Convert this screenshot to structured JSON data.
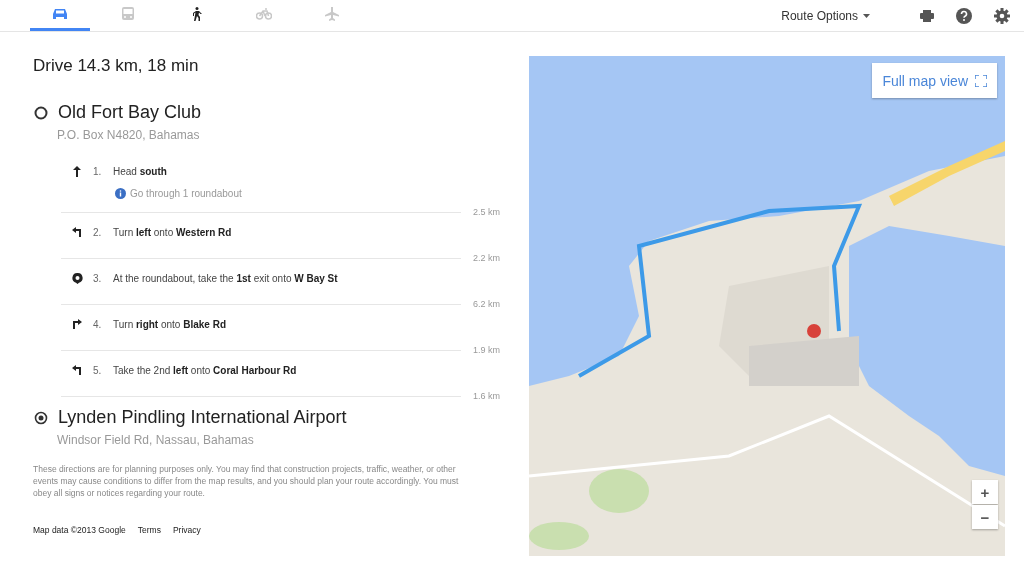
{
  "modes": [
    {
      "kind": "car",
      "selected": true,
      "disabled": false
    },
    {
      "kind": "transit",
      "selected": false,
      "disabled": true
    },
    {
      "kind": "walk",
      "selected": false,
      "disabled": false
    },
    {
      "kind": "bike",
      "selected": false,
      "disabled": true
    },
    {
      "kind": "plane",
      "selected": false,
      "disabled": true
    }
  ],
  "toolbar": {
    "route_options": "Route Options"
  },
  "summary": "Drive 14.3 km, 18 min",
  "origin": {
    "name": "Old Fort Bay Club",
    "address": "P.O. Box N4820, Bahamas"
  },
  "steps": [
    {
      "kind": "straight",
      "number": "1.",
      "text": "Head **south**",
      "note": "Go through 1 roundabout",
      "distance": "2.5 km"
    },
    {
      "kind": "left",
      "number": "2.",
      "text": "Turn **left** onto **Western Rd**",
      "distance": "2.2 km"
    },
    {
      "kind": "roundabout",
      "number": "3.",
      "text": "At the roundabout, take the **1st** exit onto **W Bay St**",
      "distance": "6.2 km"
    },
    {
      "kind": "right",
      "number": "4.",
      "text": "Turn **right** onto **Blake Rd**",
      "distance": "1.9 km"
    },
    {
      "kind": "left",
      "number": "5.",
      "text": "Take the 2nd **left** onto **Coral Harbour Rd**",
      "distance": "1.6 km"
    }
  ],
  "destination": {
    "name": "Lynden Pindling International Airport",
    "address": "Windsor Field Rd, Nassau, Bahamas"
  },
  "disclaimer": "These directions are for planning purposes only. You may find that construction projects, traffic, weather, or other events may cause conditions to differ from the map results, and you should plan your route accordingly. You must obey all signs or notices regarding your route.",
  "footer_links": [
    "Map data ©2013 Google",
    "Terms",
    "Privacy"
  ],
  "map": {
    "full_map_button": "Full map view",
    "zoom_in": "+",
    "zoom_out": "−"
  }
}
